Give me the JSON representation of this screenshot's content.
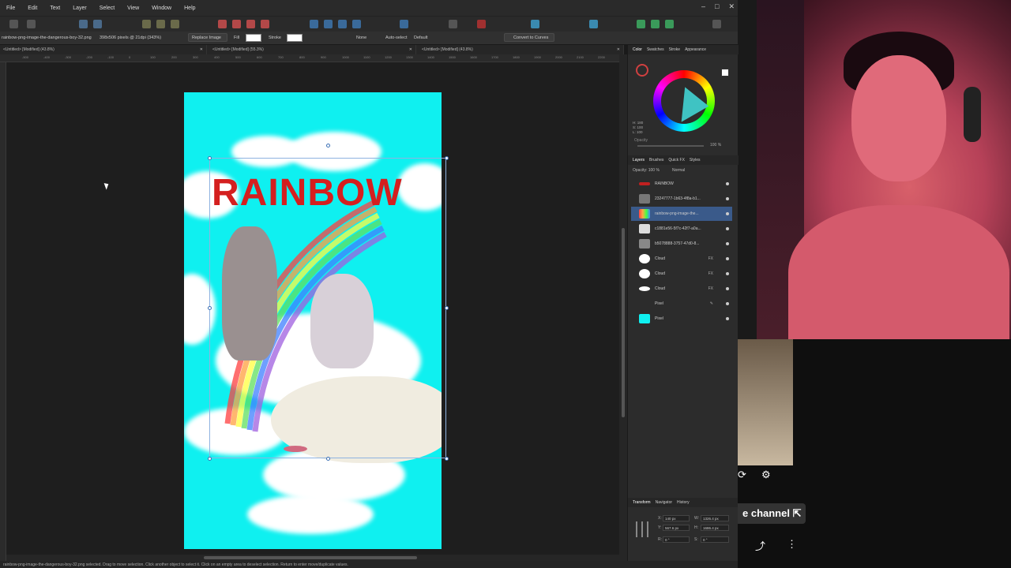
{
  "menu": [
    "File",
    "Edit",
    "Text",
    "Layer",
    "Select",
    "View",
    "Window",
    "Help"
  ],
  "window_controls": [
    "–",
    "□",
    "✕"
  ],
  "context": {
    "doc_name": "rainbow-png-image-the-dangerous-boy-32.png",
    "doc_info": "398x506 pixels @ 21dpi (343%)",
    "replace_image": "Replace Image",
    "fill_label": "Fill",
    "stroke_label": "Stroke",
    "stroke_none": "None",
    "autoselect_label": "Auto-select",
    "autoselect_value": "Default",
    "convert_curves": "Convert to Curves"
  },
  "tabs": [
    "<Untitled> [Modified] (43.8%)",
    "<Untitled> [Modified] (55.3%)",
    "<Untitled> [Modified] (43.8%)"
  ],
  "ruler_ticks": [
    "-500",
    "-400",
    "-300",
    "-200",
    "-100",
    "0",
    "100",
    "200",
    "300",
    "400",
    "500",
    "600",
    "700",
    "800",
    "900",
    "1000",
    "1100",
    "1200",
    "1300",
    "1400",
    "1500",
    "1600",
    "1700",
    "1800",
    "1900",
    "2000",
    "2100",
    "2200",
    "2300"
  ],
  "artboard": {
    "title": "RAINBOW",
    "bg_color": "#0ff0f0",
    "title_color": "#d41f1f"
  },
  "status": "rainbow-png-image-the-dangerous-boy-32.png selected. Drag to move selection. Click another object to select it. Click on an empty area to deselect selection. Return to enter move/duplicate values.",
  "panel": {
    "color_tabs": [
      "Color",
      "Swatches",
      "Stroke",
      "Appearance"
    ],
    "hsl": [
      "H: 180",
      "S: 100",
      "L: 100"
    ],
    "opacity_label": "Opacity",
    "opacity_value": "100 %",
    "layer_tabs": [
      "Layers",
      "Brushes",
      "Quick FX",
      "Styles"
    ],
    "layer_opacity": "Opacity: 100 %",
    "blend_mode": "Normal",
    "layers": [
      {
        "name": "RAINBOW",
        "fx": ""
      },
      {
        "name": "23247777-1b63-4f8a-b1...",
        "fx": ""
      },
      {
        "name": "rainbow-png-image-the...",
        "fx": ""
      },
      {
        "name": "c1881e56-5f7c-42f7-a0a...",
        "fx": ""
      },
      {
        "name": "b5078888-3757-47d0-8...",
        "fx": ""
      },
      {
        "name": "Cloud",
        "fx": "FX"
      },
      {
        "name": "Cloud",
        "fx": "FX"
      },
      {
        "name": "Cloud",
        "fx": "FX"
      },
      {
        "name": "Pixel",
        "fx": ""
      },
      {
        "name": "Pixel",
        "fx": ""
      }
    ],
    "bottom_tabs": [
      "Transform",
      "Navigator",
      "History"
    ],
    "transform": {
      "x": "140 px",
      "y": "567.6 px",
      "w": "1326.4 px",
      "h": "1686.4 px",
      "r": "0 °",
      "s": "0 °"
    },
    "transform_labels": {
      "x": "X:",
      "y": "Y:",
      "w": "W:",
      "h": "H:",
      "r": "R:",
      "s": "S:"
    }
  },
  "youtube": {
    "channel_btn": "e channel ⇱",
    "icons": [
      "⟳",
      "⚙",
      "⤴",
      "⋮"
    ]
  }
}
